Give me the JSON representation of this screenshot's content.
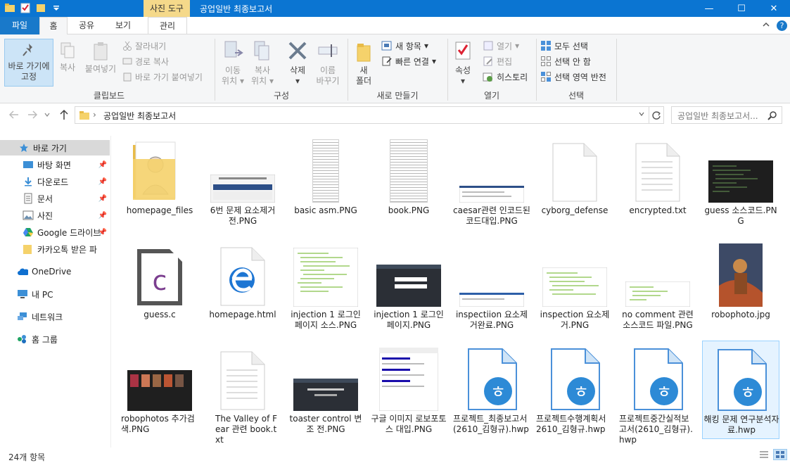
{
  "window": {
    "tool_tab": "사진 도구",
    "title": "공업일반 최종보고서",
    "min_glyph": "—",
    "max_glyph": "☐",
    "close_glyph": "✕"
  },
  "menu": {
    "file": "파일",
    "tabs": [
      "홈",
      "공유",
      "보기",
      "관리"
    ]
  },
  "ribbon": {
    "clipboard": {
      "pin_label_1": "바로 가기에",
      "pin_label_2": "고정",
      "copy": "복사",
      "paste": "붙여넣기",
      "cut": "잘라내기",
      "copy_path": "경로 복사",
      "paste_shortcut": "바로 가기 붙여넣기",
      "group": "클립보드"
    },
    "organize": {
      "move_1": "이동",
      "move_2": "위치",
      "copyto_1": "복사",
      "copyto_2": "위치",
      "delete": "삭제",
      "rename_1": "이름",
      "rename_2": "바꾸기",
      "group": "구성"
    },
    "new": {
      "folder_1": "새",
      "folder_2": "폴더",
      "new_item": "새 항목",
      "easy_access": "빠른 연결",
      "group": "새로 만들기"
    },
    "open": {
      "properties": "속성",
      "open": "열기",
      "edit": "편집",
      "history": "히스토리",
      "group": "열기"
    },
    "select": {
      "select_all": "모두 선택",
      "select_none": "선택 안 함",
      "invert": "선택 영역 반전",
      "group": "선택"
    }
  },
  "address": {
    "path": "공업일반 최종보고서",
    "search_placeholder": "공업일반 최종보고서..."
  },
  "nav": {
    "quick_access": "바로 가기",
    "items": [
      "바탕 화면",
      "다운로드",
      "문서",
      "사진",
      "Google 드라이브",
      "카카오톡 받은 파"
    ],
    "onedrive": "OneDrive",
    "pc": "내 PC",
    "network": "네트워크",
    "homegroup": "홈 그룹"
  },
  "files": [
    {
      "name": "homepage_files",
      "kind": "folder"
    },
    {
      "name": "6번 문제 요소제거 전.PNG",
      "kind": "screenshot"
    },
    {
      "name": "basic asm.PNG",
      "kind": "text-png"
    },
    {
      "name": "book.PNG",
      "kind": "text-png"
    },
    {
      "name": "caesar관련 인코드된 코드대입.PNG",
      "kind": "screenshot"
    },
    {
      "name": "cyborg_defense",
      "kind": "blank"
    },
    {
      "name": "encrypted.txt",
      "kind": "txt"
    },
    {
      "name": "guess 소스코드.PNG",
      "kind": "dark"
    },
    {
      "name": "guess.c",
      "kind": "c"
    },
    {
      "name": "homepage.html",
      "kind": "edge"
    },
    {
      "name": "injection 1 로그인페이지 소스.PNG",
      "kind": "code"
    },
    {
      "name": "injection 1 로그인페이지.PNG",
      "kind": "dark"
    },
    {
      "name": "inspectiion 요소제거완료.PNG",
      "kind": "screenshot"
    },
    {
      "name": "inspection 요소제거.PNG",
      "kind": "code"
    },
    {
      "name": "no comment 관련 소스코드 파일.PNG",
      "kind": "code"
    },
    {
      "name": "robophoto.jpg",
      "kind": "photo"
    },
    {
      "name": "robophotos 추가검색.PNG",
      "kind": "dark"
    },
    {
      "name": "The Valley of Fear 관련 book.txt",
      "kind": "txt"
    },
    {
      "name": "toaster control 변조 전.PNG",
      "kind": "dark"
    },
    {
      "name": "구글 이미지 로보포토스 대입.PNG",
      "kind": "screenshot"
    },
    {
      "name": "프로젝트_최종보고서(2610_김형규).hwp",
      "kind": "hwp"
    },
    {
      "name": "프로젝트수행계획서 2610_김형규.hwp",
      "kind": "hwp"
    },
    {
      "name": "프로젝트중간실적보고서(2610_김형규).hwp",
      "kind": "hwp"
    },
    {
      "name": "해킹 문제 연구분석자료.hwp",
      "kind": "hwp"
    }
  ],
  "status": {
    "count": "24개 항목"
  },
  "colors": {
    "titlebar": "#0b75d2",
    "file_tab": "#1979ca",
    "tool_tab": "#f5d98a",
    "selection": "#cce4f7"
  }
}
